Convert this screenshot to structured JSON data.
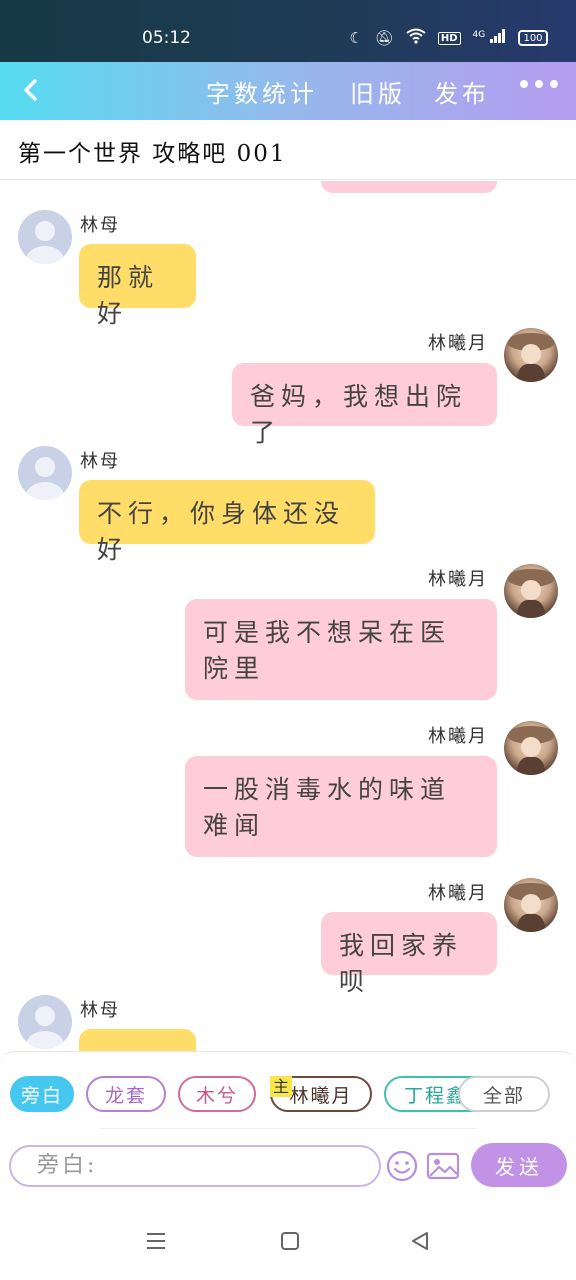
{
  "status_bar": {
    "time": "05:12",
    "network": "4G",
    "hd": "HD",
    "battery": "100"
  },
  "header": {
    "menu": [
      "字数统计",
      "旧版",
      "发布"
    ]
  },
  "subtitle": "第一个世界 攻略吧 001",
  "messages": [
    {
      "side": "left",
      "name": "林母",
      "text": "那就好"
    },
    {
      "side": "right",
      "name": "林曦月",
      "text": "爸妈，我想出院了"
    },
    {
      "side": "left",
      "name": "林母",
      "text": "不行，你身体还没好"
    },
    {
      "side": "right",
      "name": "林曦月",
      "text": "可是我不想呆在医院里"
    },
    {
      "side": "right",
      "name": "林曦月",
      "text": "一股消毒水的味道难闻"
    },
    {
      "side": "right",
      "name": "林曦月",
      "text": "我回家养呗"
    },
    {
      "side": "left",
      "name": "林母",
      "text": ""
    }
  ],
  "chips": [
    "旁白",
    "龙套",
    "木兮",
    "林曦月",
    "丁程鑫",
    "全部"
  ],
  "main_badge": "主",
  "input": {
    "placeholder": "旁白:"
  },
  "send_label": "发送",
  "colors": {
    "header_start": "#55dbf0",
    "header_end": "#b49cee",
    "left_bubble": "#ffdd68",
    "right_bubble": "#ffccd9",
    "send": "#c292e6",
    "active_chip": "#46c7ef"
  }
}
